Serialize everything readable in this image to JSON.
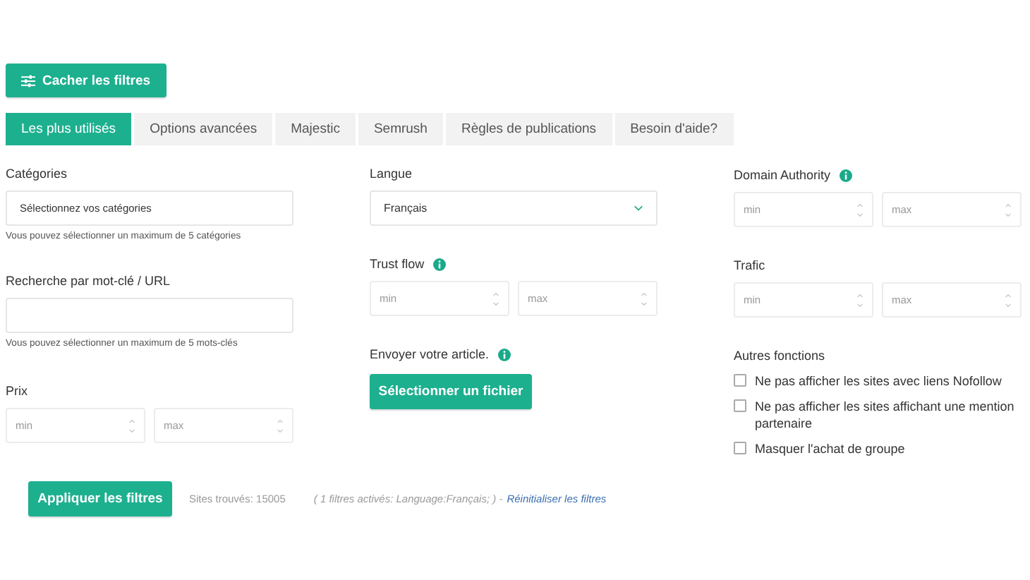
{
  "filter_toggle": {
    "label": "Cacher les filtres"
  },
  "tabs": [
    {
      "label": "Les plus utilisés",
      "selected": true
    },
    {
      "label": "Options avancées",
      "selected": false
    },
    {
      "label": "Majestic",
      "selected": false
    },
    {
      "label": "Semrush",
      "selected": false
    },
    {
      "label": "Règles de publications",
      "selected": false
    },
    {
      "label": "Besoin d'aide?",
      "selected": false
    }
  ],
  "columns": [
    [
      {
        "kind": "text",
        "label": "Catégories",
        "value": "Sélectionnez vos catégories",
        "help": "Vous pouvez sélectionner un maximum de 5 catégories",
        "info": false
      },
      {
        "kind": "text",
        "label": "Recherche par mot-clé / URL",
        "help": "Vous pouvez sélectionner un maximum de 5 mots-clés",
        "info": false
      },
      {
        "kind": "range",
        "label": "Prix",
        "min_placeholder": "min",
        "max_placeholder": "max",
        "info": false
      }
    ],
    [
      {
        "kind": "select",
        "label": "Langue",
        "value": "Français",
        "info": false
      },
      {
        "kind": "range",
        "label": "Trust flow",
        "min_placeholder": "min",
        "max_placeholder": "max",
        "info": true
      },
      {
        "kind": "upload",
        "label": "Envoyer votre article.",
        "button": "Sélectionner un fichier",
        "info": true
      }
    ],
    [
      {
        "kind": "range",
        "label": "Domain Authority",
        "min_placeholder": "min",
        "max_placeholder": "max",
        "info": true
      },
      {
        "kind": "range",
        "label": "Trafic",
        "min_placeholder": "min",
        "max_placeholder": "max",
        "info": false
      },
      {
        "kind": "checkboxes",
        "label": "Autres fonctions",
        "info": false,
        "options": [
          {
            "label": "Ne pas afficher les sites avec liens Nofollow",
            "checked": false
          },
          {
            "label": "Ne pas afficher les sites affichant une mention partenaire",
            "checked": false
          },
          {
            "label": "Masquer l'achat de groupe",
            "checked": false
          }
        ]
      }
    ]
  ],
  "footer": {
    "apply": "Appliquer les filtres",
    "found": "Sites trouvés: 15005",
    "active": "( 1 filtres activés: Language:Français; ) -",
    "reset": "Réinitialiser les filtres"
  }
}
